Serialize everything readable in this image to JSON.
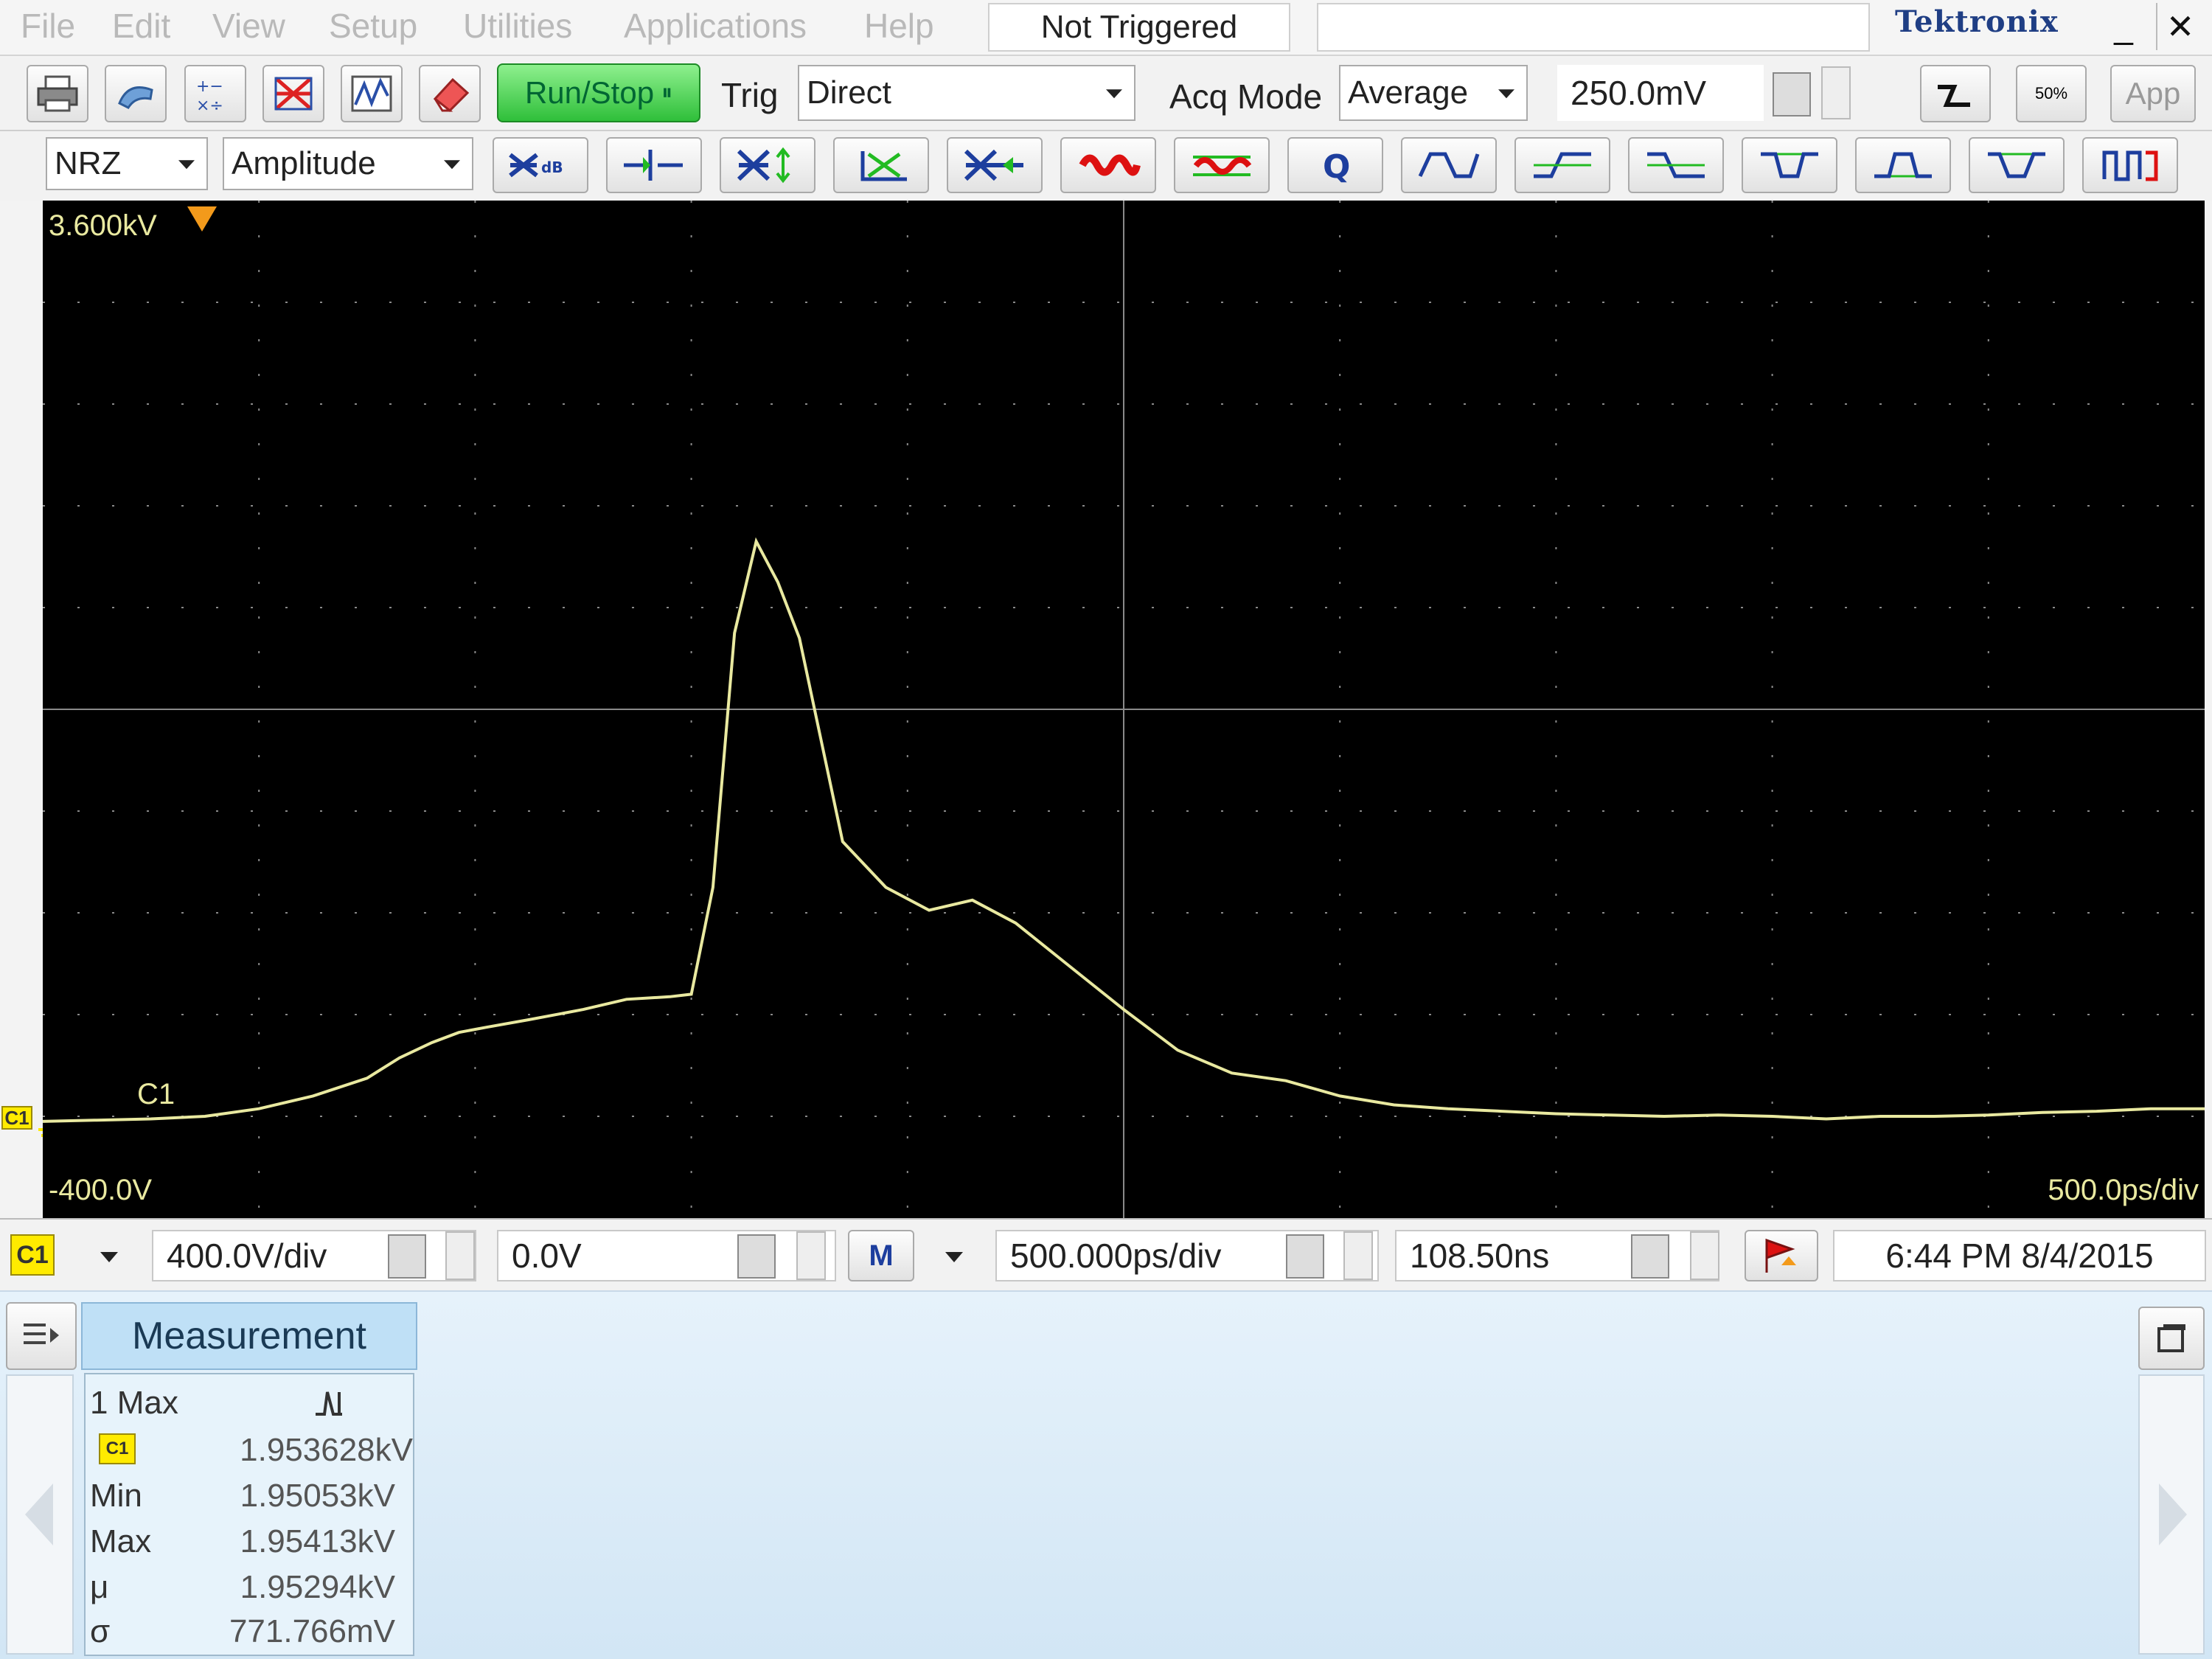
{
  "menu": [
    "File",
    "Edit",
    "View",
    "Setup",
    "Utilities",
    "Applications",
    "Help"
  ],
  "trigger_status": "Not Triggered",
  "brand": "Tektronix",
  "window_buttons": {
    "minimize": "_",
    "close": "✕"
  },
  "toolbar1": {
    "run_stop_label": "Run/Stop",
    "trig_label": "Trig",
    "trig_value": "Direct",
    "acq_mode_label": "Acq Mode",
    "acq_mode_value": "Average",
    "level_value": "250.0mV",
    "fifty_label": "50%",
    "app_label": "App"
  },
  "toolbar2": {
    "pattern_value": "NRZ",
    "measure_value": "Amplitude"
  },
  "scope": {
    "top_label": "3.600kV",
    "bottom_label": "-400.0V",
    "timebase_label": "500.0ps/div",
    "channel_label": "C1",
    "badge": "C1"
  },
  "bottom": {
    "channel_badge": "C1",
    "vdiv": "400.0V/div",
    "offset": "0.0V",
    "math_badge": "M",
    "time_div": "500.000ps/div",
    "position": "108.50ns",
    "datetime": "6:44 PM 8/4/2015"
  },
  "measurement": {
    "tab_label": "Measurement",
    "title": "1 Max",
    "channel_badge": "C1",
    "current": "1.953628kV",
    "rows": [
      {
        "label": "Min",
        "value": "1.95053kV"
      },
      {
        "label": "Max",
        "value": "1.95413kV"
      },
      {
        "label": "μ",
        "value": "1.95294kV"
      },
      {
        "label": "σ",
        "value": "771.766mV"
      }
    ]
  },
  "colors": {
    "trace": "#e9e9a0",
    "grid": "#8a8a8a",
    "badge": "#ffeb00"
  },
  "chart_data": {
    "type": "line",
    "x": [
      0,
      0.5,
      1,
      1.5,
      2,
      2.5,
      3,
      3.3,
      3.6,
      3.85,
      4.1,
      4.5,
      5.0,
      5.4,
      5.8,
      6.0,
      6.2,
      6.4,
      6.6,
      6.8,
      7.0,
      7.4,
      7.8,
      8.2,
      8.6,
      9.0,
      9.5,
      10,
      10.5,
      11,
      11.5,
      12,
      12.5,
      13,
      13.5,
      14,
      14.5,
      15,
      15.5,
      16,
      16.5,
      17,
      17.5,
      18,
      18.5,
      19,
      19.5,
      20
    ],
    "values": [
      -20,
      -15,
      -10,
      0,
      30,
      80,
      150,
      230,
      290,
      330,
      350,
      380,
      420,
      460,
      470,
      480,
      900,
      1900,
      2260,
      2100,
      1880,
      1080,
      900,
      810,
      850,
      760,
      590,
      420,
      260,
      170,
      140,
      80,
      45,
      30,
      20,
      10,
      5,
      0,
      5,
      0,
      -10,
      0,
      0,
      5,
      15,
      20,
      30,
      30
    ],
    "ylim": [
      -400,
      3600
    ],
    "xlim": [
      0,
      20
    ],
    "grid": true
  }
}
